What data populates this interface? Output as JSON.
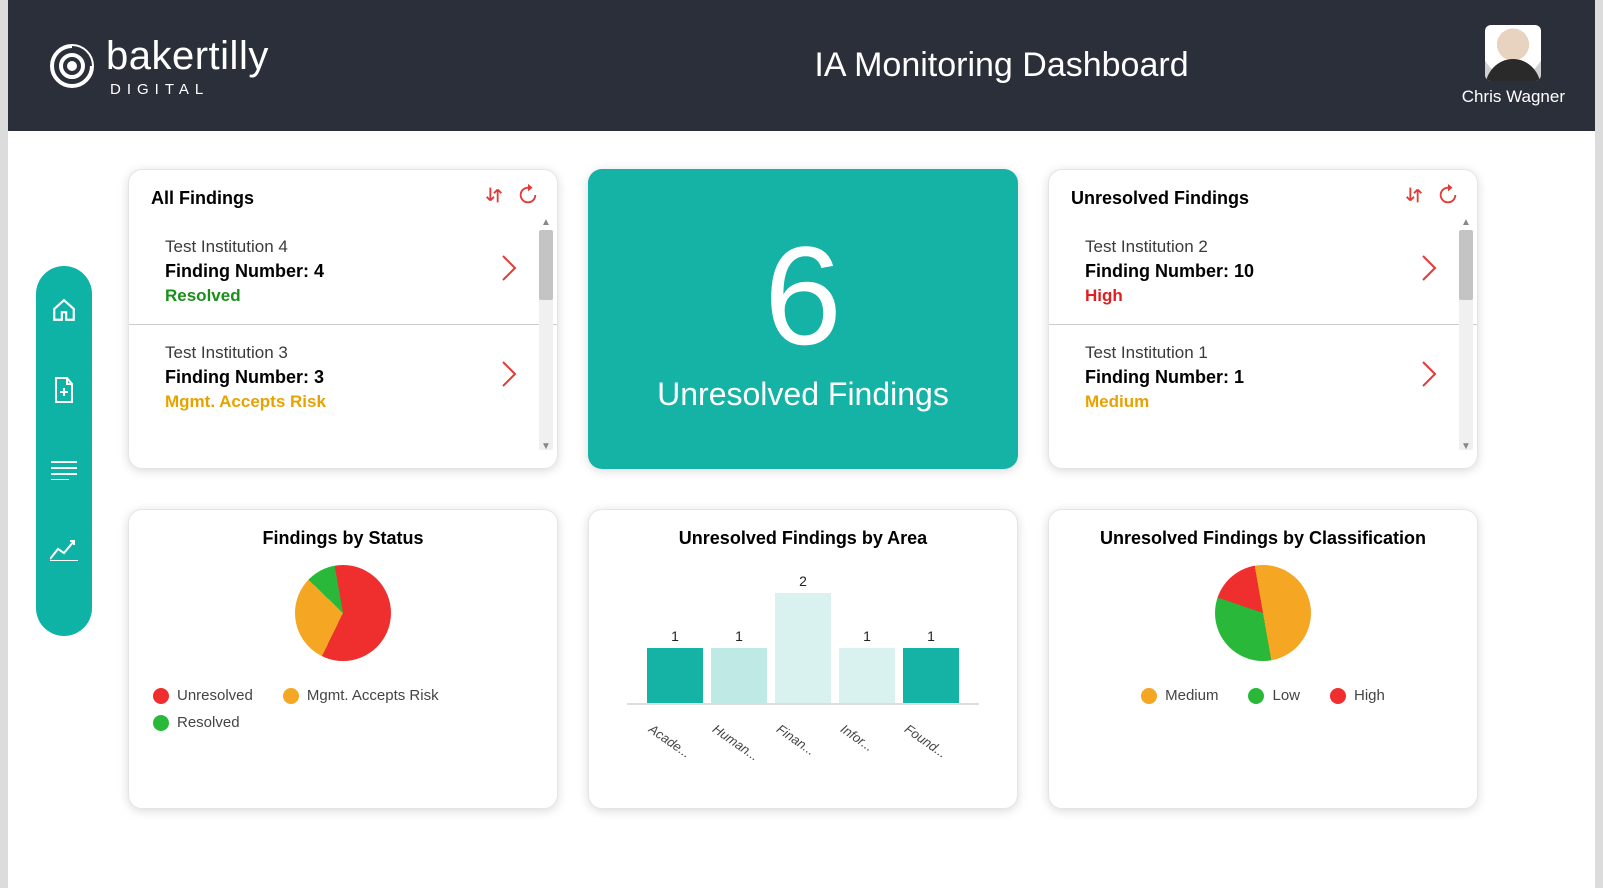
{
  "header": {
    "logo_name": "bakertilly",
    "logo_sub": "DIGITAL",
    "page_title": "IA Monitoring Dashboard",
    "user_name": "Chris Wagner"
  },
  "big_tile": {
    "count": "6",
    "label": "Unresolved Findings"
  },
  "all_findings": {
    "title": "All Findings",
    "items": [
      {
        "institution": "Test Institution 4",
        "finding_label": "Finding Number: 4",
        "status": "Resolved",
        "status_key": "Resolved"
      },
      {
        "institution": "Test Institution 3",
        "finding_label": "Finding Number: 3",
        "status": "Mgmt. Accepts Risk",
        "status_key": "MgmtAcceptsRisk"
      }
    ]
  },
  "unresolved_findings": {
    "title": "Unresolved Findings",
    "items": [
      {
        "institution": "Test Institution 2",
        "finding_label": "Finding Number: 10",
        "status": "High",
        "status_key": "High"
      },
      {
        "institution": "Test Institution 1",
        "finding_label": "Finding Number: 1",
        "status": "Medium",
        "status_key": "Medium"
      }
    ]
  },
  "charts": {
    "status_title": "Findings by Status",
    "area_title": "Unresolved Findings by Area",
    "classification_title": "Unresolved Findings by Classification"
  },
  "colors": {
    "unresolved": "#ef2e2e",
    "resolved": "#2ab83a",
    "mgmt": "#f5a623",
    "medium": "#f5a623",
    "low": "#2ab83a",
    "high": "#ef2e2e",
    "teal": "#14b3a6"
  },
  "chart_data": [
    {
      "id": "findings_by_status",
      "type": "pie",
      "title": "Findings by Status",
      "series": [
        {
          "name": "Unresolved",
          "value": 60,
          "color": "#ef2e2e"
        },
        {
          "name": "Mgmt. Accepts Risk",
          "value": 30,
          "color": "#f5a623"
        },
        {
          "name": "Resolved",
          "value": 10,
          "color": "#2ab83a"
        }
      ],
      "legend": [
        "Unresolved",
        "Mgmt. Accepts Risk",
        "Resolved"
      ]
    },
    {
      "id": "unresolved_by_area",
      "type": "bar",
      "title": "Unresolved Findings by Area",
      "categories": [
        "Acade...",
        "Human...",
        "Finan...",
        "Infor...",
        "Found..."
      ],
      "values": [
        1,
        1,
        2,
        1,
        1
      ],
      "ylim": [
        0,
        2
      ]
    },
    {
      "id": "unresolved_by_classification",
      "type": "pie",
      "title": "Unresolved Findings by Classification",
      "series": [
        {
          "name": "Medium",
          "value": 50,
          "color": "#f5a623"
        },
        {
          "name": "Low",
          "value": 33,
          "color": "#2ab83a"
        },
        {
          "name": "High",
          "value": 17,
          "color": "#ef2e2e"
        }
      ],
      "legend": [
        "Medium",
        "Low",
        "High"
      ]
    }
  ]
}
